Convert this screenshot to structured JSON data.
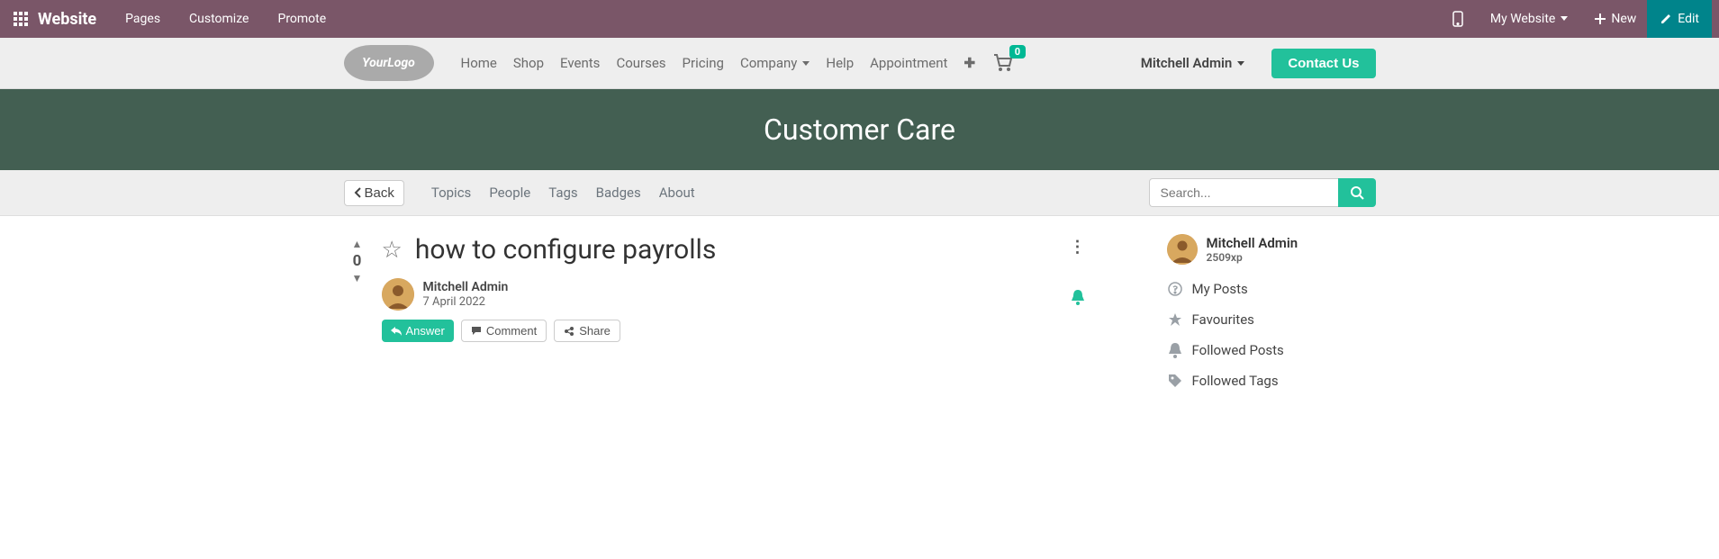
{
  "topbar": {
    "app": "Website",
    "menu": [
      "Pages",
      "Customize",
      "Promote"
    ],
    "my_website": "My Website",
    "new": "New",
    "edit": "Edit"
  },
  "nav": {
    "links": [
      "Home",
      "Shop",
      "Events",
      "Courses",
      "Pricing",
      "Company",
      "Help",
      "Appointment"
    ],
    "cart_count": "0",
    "user": "Mitchell Admin",
    "contact": "Contact Us"
  },
  "hero": {
    "title": "Customer Care"
  },
  "subnav": {
    "back": "Back",
    "links": [
      "Topics",
      "People",
      "Tags",
      "Badges",
      "About"
    ],
    "search_placeholder": "Search..."
  },
  "question": {
    "votes": "0",
    "title": "how to configure payrolls",
    "author": "Mitchell Admin",
    "date": "7 April 2022",
    "answer": "Answer",
    "comment": "Comment",
    "share": "Share"
  },
  "profile": {
    "name": "Mitchell Admin",
    "xp": "2509xp"
  },
  "sidelinks": {
    "my_posts": "My Posts",
    "favourites": "Favourites",
    "followed_posts": "Followed Posts",
    "followed_tags": "Followed Tags"
  }
}
